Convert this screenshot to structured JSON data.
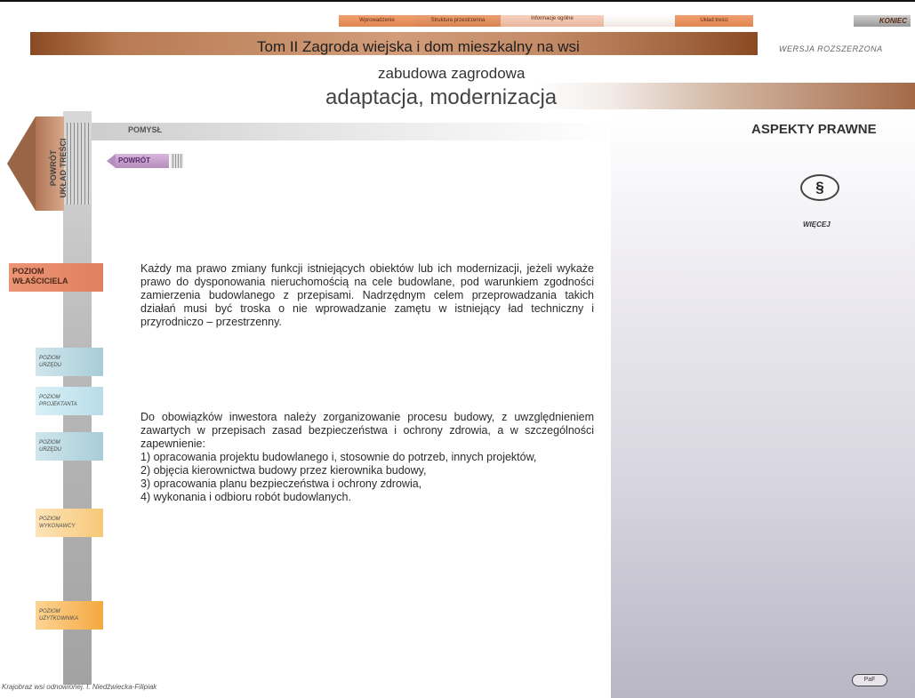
{
  "nav": {
    "tabs": [
      {
        "label": "Wprowadzenie"
      },
      {
        "label": "Struktura przestrzenna"
      },
      {
        "label": "Informacje ogólne"
      },
      {
        "label": ""
      },
      {
        "label": "Układ treści"
      }
    ],
    "koniec": "KONIEC"
  },
  "header": {
    "title": "Tom II Zagroda wiejska i dom mieszkalny na wsi",
    "version": "WERSJA ROZSZERZONA",
    "subtitle": "zabudowa zagrodowa",
    "heading": "adaptacja, modernizacja"
  },
  "section": {
    "label": "POMYSŁ",
    "back_button": "POWRÓT",
    "aspects_title": "ASPEKTY PRAWNE",
    "law_icon_symbol": "§",
    "law_label": "WIĘCEJ"
  },
  "sidebar": {
    "powrot_line1": "POWRÓT",
    "powrot_line2": "UKŁAD TREŚCI",
    "active_level_line1": "POZIOM",
    "active_level_line2": "WŁAŚCICIELA",
    "levels": [
      {
        "line1": "POZIOM",
        "line2": "URZĘDU"
      },
      {
        "line1": "POZIOM",
        "line2": "PROJEKTANTA"
      },
      {
        "line1": "POZIOM",
        "line2": "URZĘDU"
      },
      {
        "line1": "POZIOM",
        "line2": "WYKONAWCY"
      },
      {
        "line1": "POZIOM",
        "line2": "UŻYTKOWNIKA"
      }
    ]
  },
  "content": {
    "paragraph1": "Każdy ma prawo zmiany funkcji istniejących obiektów lub ich modernizacji, jeżeli wykaże prawo do dysponowania nieruchomością na cele budowlane, pod warunkiem zgodności zamierzenia budowlanego z przepisami. Nadrzędnym celem przeprowadzania takich działań musi być troska o nie wprowadzanie zamętu w istniejący ład techniczny i przyrodniczo – przestrzenny.",
    "paragraph2_intro": "Do obowiązków inwestora należy zorganizowanie procesu budowy, z uwzględnieniem zawartych w przepisach zasad bezpieczeństwa i ochrony zdrowia, a w szczególności zapewnienie:",
    "items": [
      "1) opracowania projektu budowlanego i, stosownie do potrzeb, innych projektów,",
      "2) objęcia kierownictwa budowy przez kierownika budowy,",
      "3) opracowania planu bezpieczeństwa i ochrony zdrowia,",
      "4) wykonania i odbioru robót budowlanych."
    ]
  },
  "footer": {
    "credit": "Krajobraz wsi odnowionej. I. Niedźwiecka-Filipiak",
    "paf": "PaF"
  }
}
